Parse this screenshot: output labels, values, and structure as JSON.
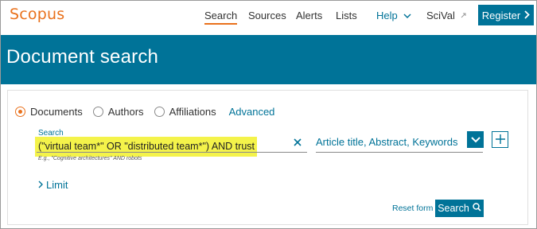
{
  "header": {
    "logo": "Scopus",
    "nav": {
      "search": "Search",
      "sources": "Sources",
      "alerts": "Alerts",
      "lists": "Lists",
      "help": "Help",
      "scival": "SciVal"
    },
    "register": "Register"
  },
  "banner": {
    "title": "Document search"
  },
  "search_type": {
    "options": [
      "Documents",
      "Authors",
      "Affiliations"
    ],
    "selected": "Documents",
    "advanced": "Advanced"
  },
  "search_form": {
    "label": "Search",
    "query": "(\"virtual team*\" OR \"distributed team*\") AND trust",
    "hint": "E.g., \"Cognitive architectures\" AND robots",
    "field": "Article title, Abstract, Keywords",
    "limit": "Limit",
    "reset": "Reset form",
    "search_button": "Search"
  },
  "colors": {
    "brand": "#007398",
    "accent": "#e9711c",
    "highlight": "#f4f34a"
  },
  "icons": {
    "help_dropdown": "chevron-down-icon",
    "scival_link": "external-link-icon",
    "register": "chevron-right-icon",
    "clear": "close-icon",
    "field_dropdown": "chevron-down-icon",
    "add_field": "plus-icon",
    "limit": "chevron-right-icon",
    "search": "search-icon"
  }
}
